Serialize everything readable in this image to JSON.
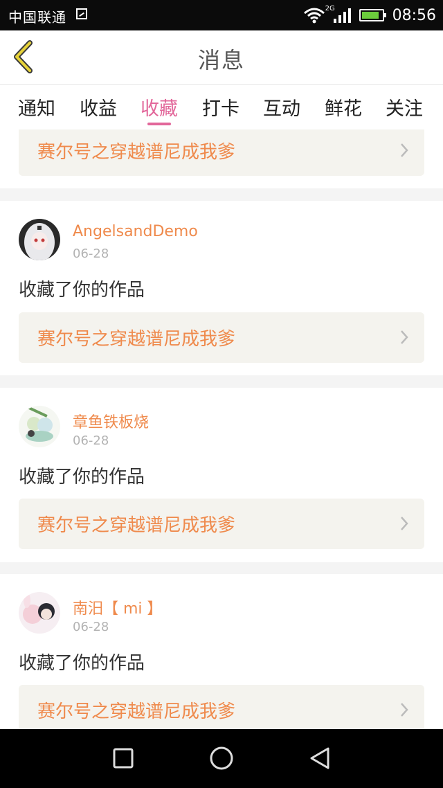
{
  "status_bar": {
    "carrier": "中国联通",
    "network": "2G",
    "time": "08:56"
  },
  "header": {
    "title": "消息",
    "back_icon": "chevron-left-icon"
  },
  "tabs": [
    {
      "label": "通知",
      "active": false
    },
    {
      "label": "收益",
      "active": false
    },
    {
      "label": "收藏",
      "active": true
    },
    {
      "label": "打卡",
      "active": false
    },
    {
      "label": "互动",
      "active": false
    },
    {
      "label": "鲜花",
      "active": false
    },
    {
      "label": "关注",
      "active": false
    }
  ],
  "items": [
    {
      "username": "",
      "date": "",
      "action": "",
      "work_title": "赛尔号之穿越谱尼成我爹"
    },
    {
      "username": "AngelsandDemo",
      "date": "06-28",
      "action": "收藏了你的作品",
      "work_title": "赛尔号之穿越谱尼成我爹"
    },
    {
      "username": "章鱼铁板烧",
      "date": "06-28",
      "action": "收藏了你的作品",
      "work_title": "赛尔号之穿越谱尼成我爹"
    },
    {
      "username": "南汨【 mi 】",
      "date": "06-28",
      "action": "收藏了你的作品",
      "work_title": "赛尔号之穿越谱尼成我爹"
    }
  ],
  "colors": {
    "accent": "#e2679a",
    "username": "#ef8a4c",
    "work_box": "#f4f3ee"
  },
  "nav": [
    "square-recents-icon",
    "circle-home-icon",
    "triangle-back-icon"
  ]
}
